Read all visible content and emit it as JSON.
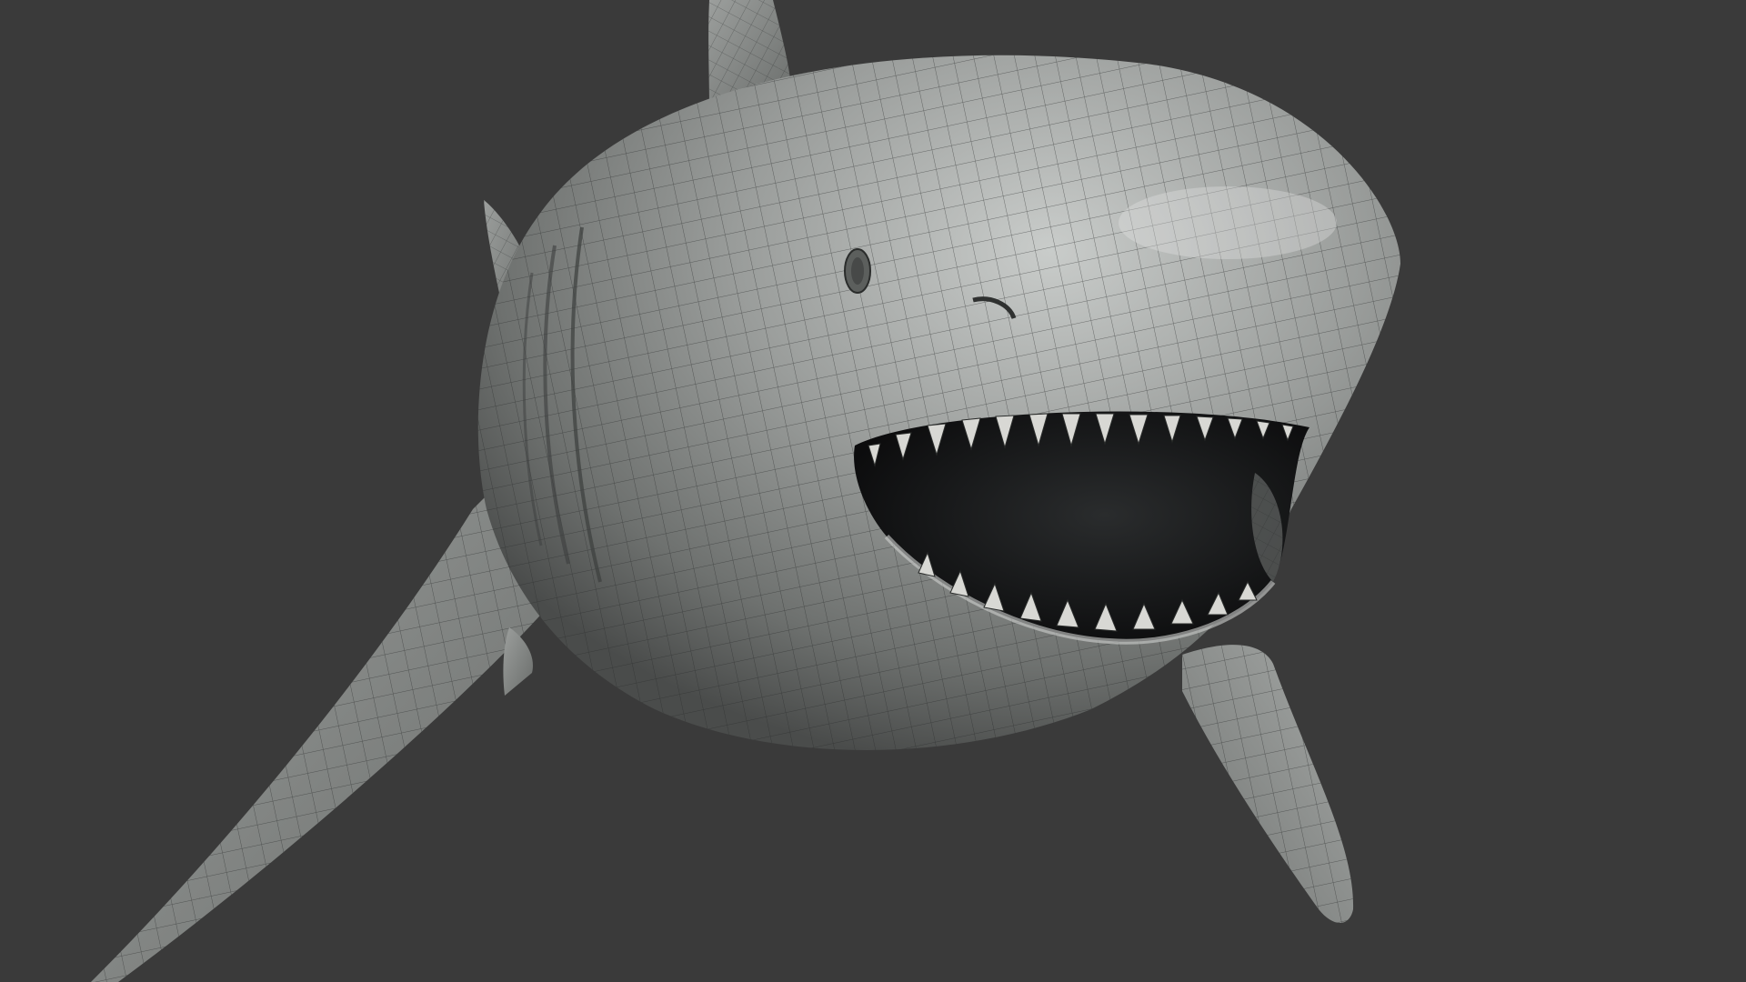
{
  "viewport": {
    "background_color": "#3a3a3a",
    "subject": "shark-wireframe-model"
  },
  "colors": {
    "body_light": "#b9bcba",
    "body_mid": "#8a8d8b",
    "body_dark": "#4e504f",
    "wire": "#2a2c2b",
    "mouth_dark": "#111213",
    "tooth": "#d8d8d4"
  }
}
